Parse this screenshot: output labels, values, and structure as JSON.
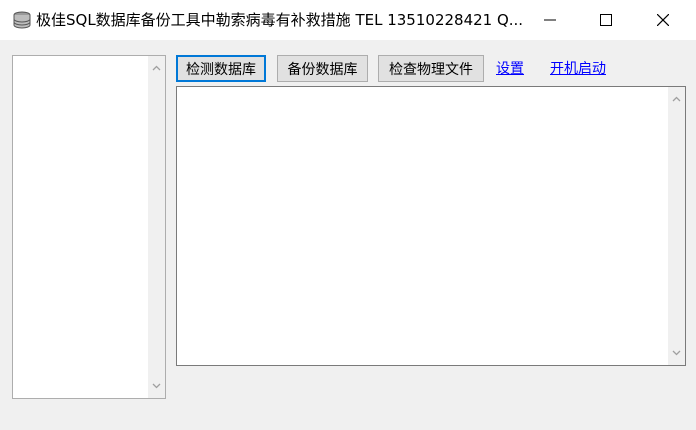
{
  "window": {
    "title": "极佳SQL数据库备份工具中勒索病毒有补救措施 TEL 13510228421 Q...",
    "minimize_glyph": "—",
    "maximize_glyph": "☐",
    "close_glyph": "✕"
  },
  "toolbar": {
    "detect_db_label": "检测数据库",
    "backup_db_label": "备份数据库",
    "check_files_label": "检查物理文件",
    "settings_link": "设置",
    "autostart_link": "开机启动"
  },
  "colors": {
    "accent": "#0078d7",
    "link": "#0000ff"
  }
}
